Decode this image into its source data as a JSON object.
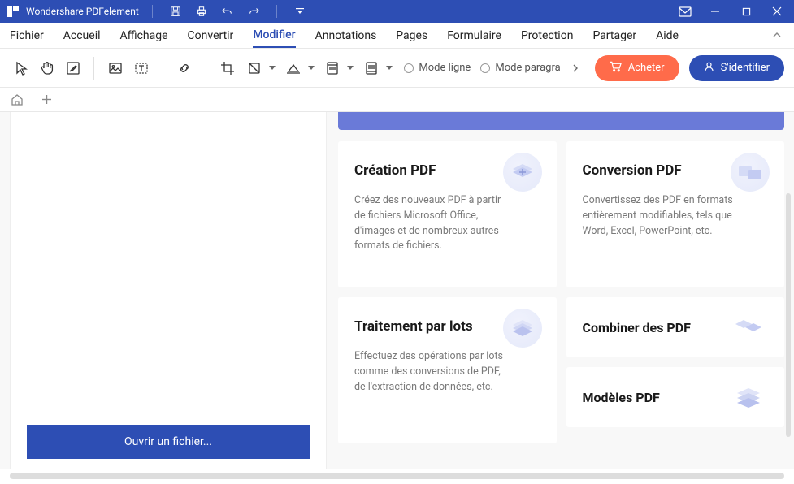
{
  "app_title": "Wondershare PDFelement",
  "menus": {
    "fichier": "Fichier",
    "accueil": "Accueil",
    "affichage": "Affichage",
    "convertir": "Convertir",
    "modifier": "Modifier",
    "annotations": "Annotations",
    "pages": "Pages",
    "formulaire": "Formulaire",
    "protection": "Protection",
    "partager": "Partager",
    "aide": "Aide"
  },
  "radios": {
    "line": "Mode ligne",
    "para": "Mode paragra"
  },
  "buttons": {
    "buy": "Acheter",
    "signin": "S'identifier",
    "open_file": "Ouvrir un fichier..."
  },
  "cards": {
    "create": {
      "title": "Création PDF",
      "desc": "Créez des nouveaux PDF à partir de fichiers Microsoft Office, d'images et de nombreux autres formats de fichiers."
    },
    "convert": {
      "title": "Conversion PDF",
      "desc": "Convertissez des PDF en formats entièrement modifiables, tels que Word, Excel, PowerPoint, etc."
    },
    "batch": {
      "title": "Traitement par lots",
      "desc": "Effectuez des opérations par lots comme des conversions de PDF, de l'extraction de données, etc."
    },
    "combine": {
      "title": "Combiner des PDF"
    },
    "templates": {
      "title": "Modèles PDF"
    }
  }
}
